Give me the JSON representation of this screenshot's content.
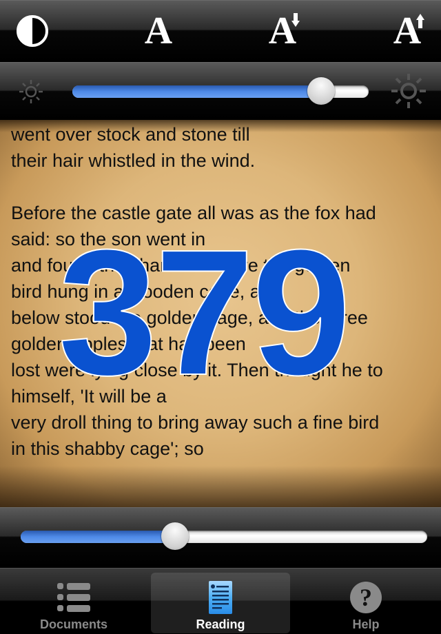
{
  "toolbar": {
    "buttons": [
      {
        "name": "contrast-toggle",
        "icon": "contrast-icon"
      },
      {
        "name": "font-style",
        "label": "A",
        "icon": "font-icon"
      },
      {
        "name": "font-decrease",
        "label": "A",
        "icon": "font-decrease-icon"
      },
      {
        "name": "font-increase",
        "label": "A",
        "icon": "font-increase-icon"
      }
    ]
  },
  "brightness": {
    "min_icon": "sun-dim-icon",
    "max_icon": "sun-bright-icon",
    "value": 0.84
  },
  "reader": {
    "page_number": "379",
    "lines": [
      "went over stock and stone till",
      "their hair whistled in the wind.",
      "",
      "Before the castle gate all was as the fox had",
      "said: so the son went in",
      "and found the chamber where the golden",
      "bird hung in a wooden cage, and",
      "below stood the golden cage, and the three",
      "golden apples that had been",
      "lost were lying close by it. Then thought he to",
      "himself, 'It will be a",
      "very droll thing to bring away such a fine bird",
      "in this shabby cage'; so"
    ]
  },
  "page_slider": {
    "value": 0.38
  },
  "tabbar": {
    "tabs": [
      {
        "label": "Documents",
        "icon": "list-icon",
        "active": false
      },
      {
        "label": "Reading",
        "icon": "document-icon",
        "active": true
      },
      {
        "label": "Help",
        "icon": "help-icon",
        "active": false
      }
    ]
  },
  "colors": {
    "accent_blue": "#0a52d0",
    "slider_fill": "#4f8ae8",
    "paper": "#ddb67a"
  }
}
